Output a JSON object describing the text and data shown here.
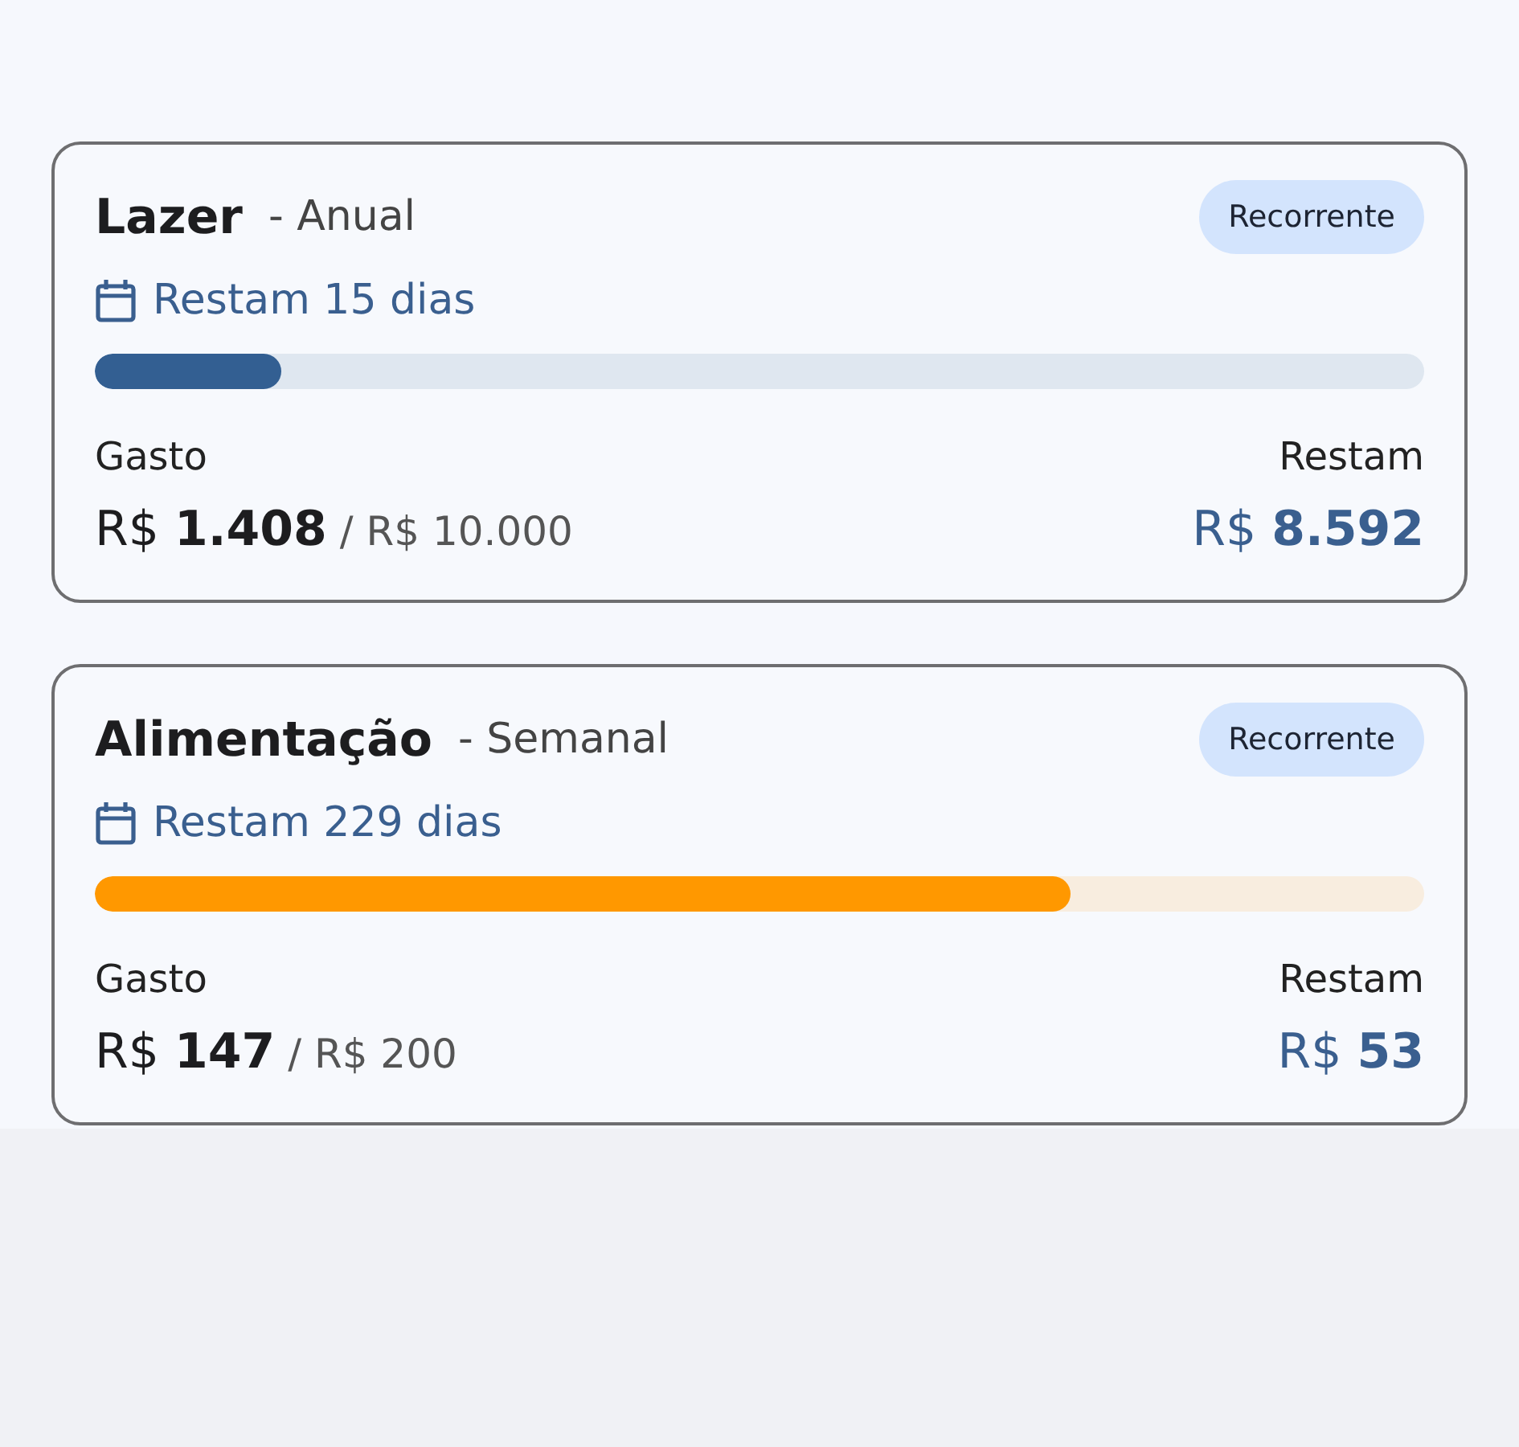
{
  "budgets": [
    {
      "name": "Lazer",
      "period": "- Anual",
      "badge": "Recorrente",
      "days_left": "Restam 15 dias",
      "level": 0.14,
      "color": "#335f92",
      "spent_label": "Gasto",
      "remaining_label": "Restam",
      "spent": "R$ **1.408**",
      "limit": "/ R$ 10.000",
      "remaining": "R$ **8.592**"
    },
    {
      "name": "Alimentação",
      "period": "- Semanal",
      "badge": "Recorrente",
      "days_left": "Restam 229 dias",
      "level": 0.734,
      "color": "#ff9800",
      "spent_label": "Gasto",
      "remaining_label": "Restam",
      "spent": "R$ **147**",
      "limit": "/ R$ 200",
      "remaining": "R$ **53**"
    }
  ]
}
